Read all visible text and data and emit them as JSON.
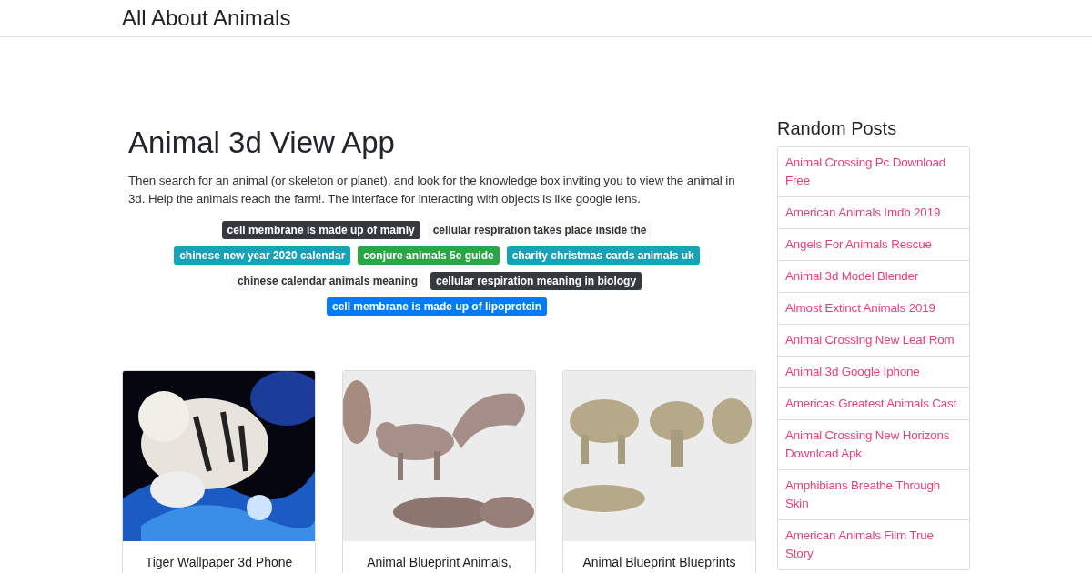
{
  "site": {
    "title": "All About Animals"
  },
  "article": {
    "title": "Animal 3d View App",
    "text": "Then search for an animal (or skeleton or planet), and look for the knowledge box inviting you to view the animal in 3d. Help the animals reach the farm!. The interface for interacting with objects is like google lens.",
    "tags": [
      {
        "label": "cell membrane is made up of mainly",
        "color": "#343a40"
      },
      {
        "label": "cellular respiration takes place inside the",
        "color": "#f8f9fa"
      },
      {
        "label": "chinese new year 2020 calendar",
        "color": "#17a2b8"
      },
      {
        "label": "conjure animals 5e guide",
        "color": "#28a745"
      },
      {
        "label": "charity christmas cards animals uk",
        "color": "#17a2b8"
      },
      {
        "label": "chinese calendar animals meaning",
        "color": "#f8f9fa"
      },
      {
        "label": "cellular respiration meaning in biology",
        "color": "#343a40"
      },
      {
        "label": "cell membrane is made up of lipoprotein",
        "color": "#007bff"
      }
    ]
  },
  "cards": [
    {
      "kind": "picture",
      "caption": "Tiger Wallpaper 3d Phone"
    },
    {
      "kind": "picture",
      "caption": "Animal Blueprint Animals,"
    },
    {
      "kind": "picture",
      "caption": "Animal Blueprint Blueprints"
    }
  ],
  "sidebar": {
    "title": "Random Posts",
    "items": [
      "Animal Crossing Pc Download Free",
      "American Animals Imdb 2019",
      "Angels For Animals Rescue",
      "Animal 3d Model Blender",
      "Almost Extinct Animals 2019",
      "Animal Crossing New Leaf Rom",
      "Animal 3d Google Iphone",
      "Americas Greatest Animals Cast",
      "Animal Crossing New Horizons Download Apk",
      "Amphibians Breathe Through Skin",
      "American Animals Film True Story"
    ]
  }
}
